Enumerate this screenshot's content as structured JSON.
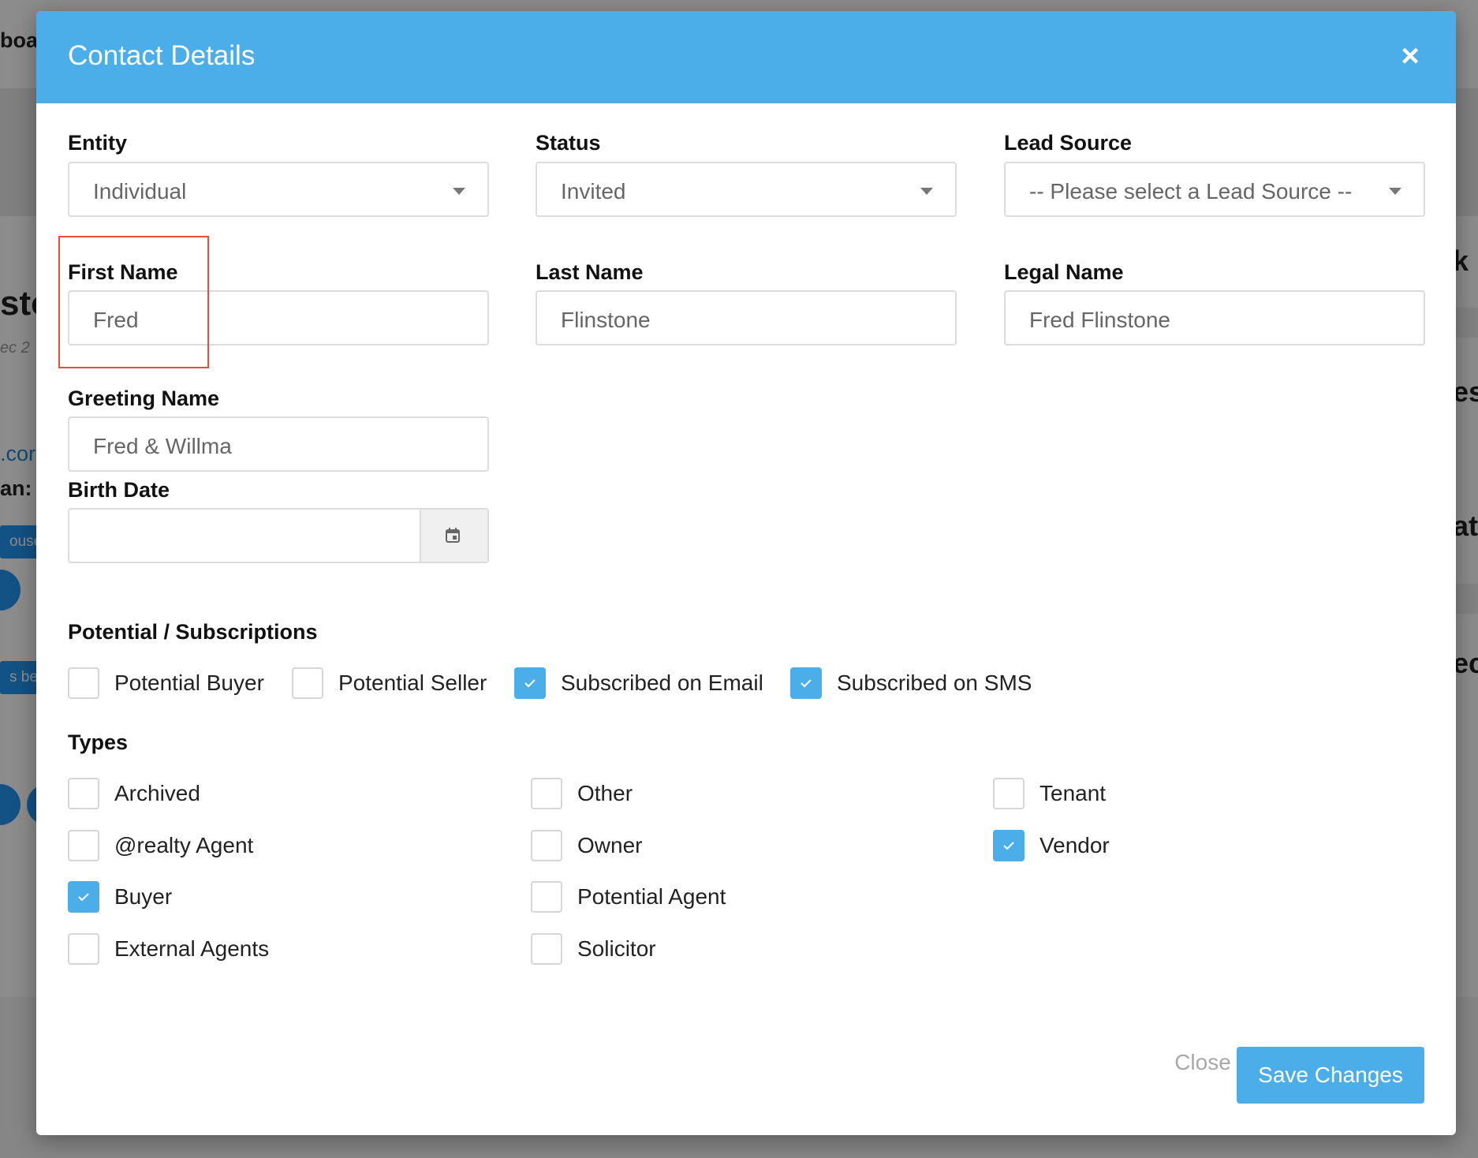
{
  "background": {
    "fragments": [
      "boa",
      "sto",
      "ec 2",
      ".cor",
      "an:",
      "ouse",
      "s bee",
      "k",
      "es",
      "at",
      "ec"
    ]
  },
  "modal": {
    "title": "Contact Details",
    "close_icon": "close-icon",
    "fields": {
      "entity": {
        "label": "Entity",
        "value": "Individual"
      },
      "status": {
        "label": "Status",
        "value": "Invited"
      },
      "lead_source": {
        "label": "Lead Source",
        "value": "-- Please select a Lead Source --"
      },
      "first_name": {
        "label": "First Name",
        "value": "Fred"
      },
      "last_name": {
        "label": "Last Name",
        "value": "Flinstone"
      },
      "legal_name": {
        "label": "Legal Name",
        "value": "Fred Flinstone"
      },
      "greeting_name": {
        "label": "Greeting Name",
        "value": "Fred & Willma"
      },
      "birth_date": {
        "label": "Birth Date",
        "value": "",
        "icon": "calendar-icon"
      }
    },
    "potential": {
      "title": "Potential / Subscriptions",
      "items": [
        {
          "label": "Potential Buyer",
          "checked": false
        },
        {
          "label": "Potential Seller",
          "checked": false
        },
        {
          "label": "Subscribed on Email",
          "checked": true
        },
        {
          "label": "Subscribed on SMS",
          "checked": true
        }
      ]
    },
    "types": {
      "title": "Types",
      "items": [
        {
          "label": "Archived",
          "checked": false
        },
        {
          "label": "@realty Agent",
          "checked": false
        },
        {
          "label": "Buyer",
          "checked": true
        },
        {
          "label": "External Agents",
          "checked": false
        },
        {
          "label": "Other",
          "checked": false
        },
        {
          "label": "Owner",
          "checked": false
        },
        {
          "label": "Potential Agent",
          "checked": false
        },
        {
          "label": "Solicitor",
          "checked": false
        },
        {
          "label": "Tenant",
          "checked": false
        },
        {
          "label": "Vendor",
          "checked": true
        }
      ]
    },
    "footer": {
      "close_label": "Close",
      "save_label": "Save Changes"
    },
    "colors": {
      "accent": "#4caee8",
      "highlight": "#e74c3c"
    }
  }
}
